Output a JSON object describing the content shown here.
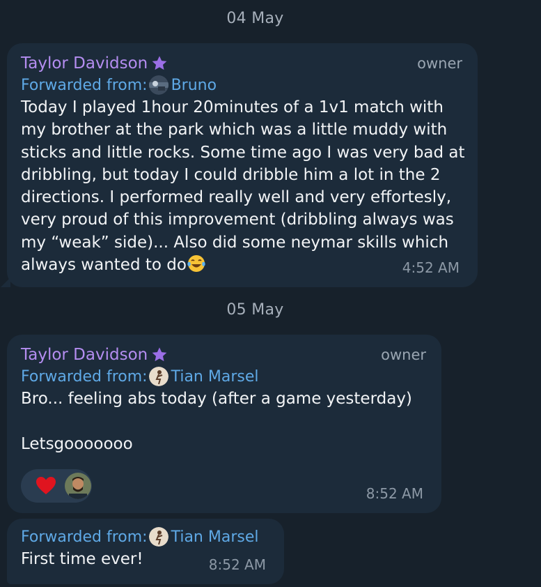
{
  "dates": [
    "04 May",
    "05 May"
  ],
  "messages": [
    {
      "sender": "Taylor Davidson",
      "role": "owner",
      "forwarded_label": "Forwarded from:",
      "forwarded_name": "Bruno",
      "text": "Today I played 1hour 20minutes of a 1v1 match with my brother at the park which was a little muddy with sticks and little rocks. Some time ago I was very bad at dribbling, but today I could dribble him a lot in the 2 directions. I performed really well and very effortesly, very proud of this improvement (dribbling always was my “weak” side)... Also did some neymar skills which always wanted to do",
      "emoji": "face-with-tears-of-joy",
      "time": "4:52 AM"
    },
    {
      "sender": "Taylor Davidson",
      "role": "owner",
      "forwarded_label": "Forwarded from:",
      "forwarded_name": "Tian Marsel",
      "text": "Bro... feeling abs today (after a game yesterday)\n\nLetsgooooooo",
      "reaction": "heart",
      "time": "8:52 AM"
    },
    {
      "forwarded_label": "Forwarded from:",
      "forwarded_name": "Tian Marsel",
      "text": "First time ever!",
      "time": "8:52 AM"
    }
  ],
  "colors": {
    "background": "#17212b",
    "bubble": "#1c2b3a",
    "sender": "#b48df0",
    "forwarded": "#5fa9e6",
    "meta": "#8d99a6"
  }
}
